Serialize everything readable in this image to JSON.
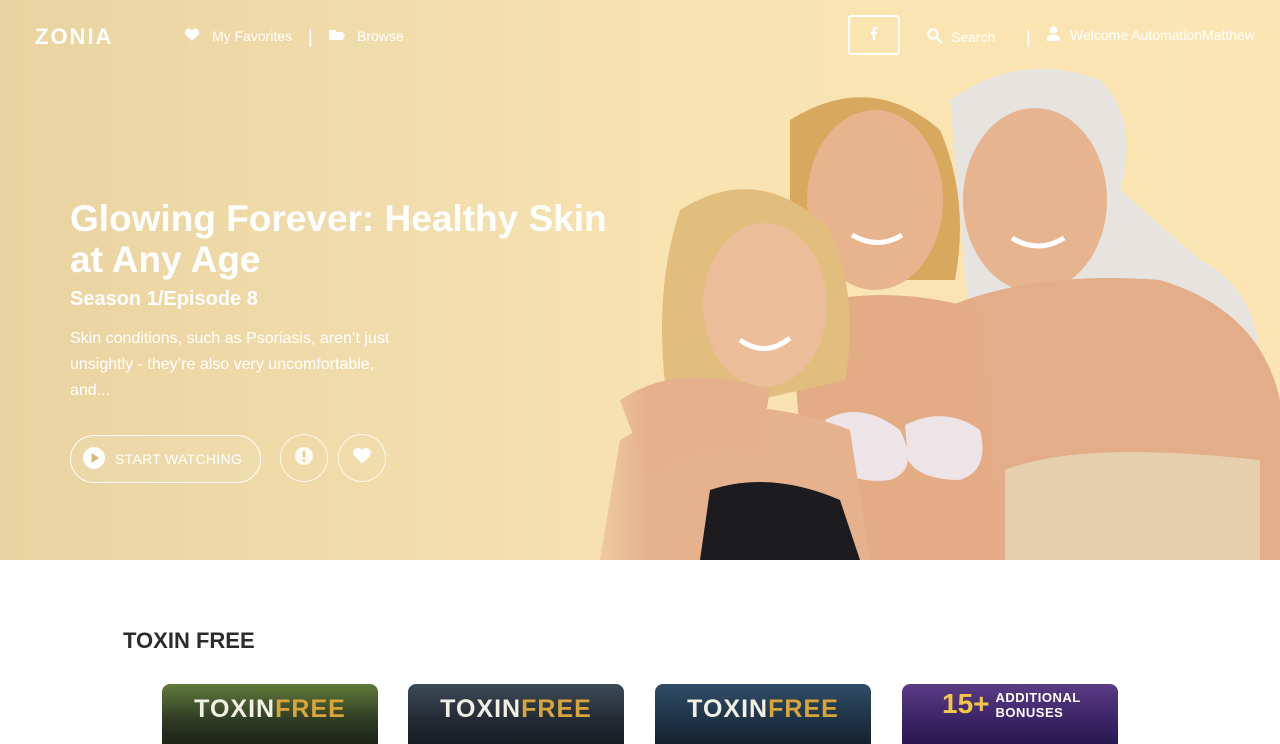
{
  "header": {
    "logo_text": "ZONIA",
    "nav": {
      "favorites_label": "My Favorites",
      "browse_label": "Browse"
    },
    "separator": "|",
    "facebook_icon": "facebook-icon",
    "search_label": "Search",
    "welcome_text": "Welcome AutomationMatthew"
  },
  "hero": {
    "title": "Glowing Forever: Healthy Skin at Any Age",
    "episode": "Season 1/Episode 8",
    "description": "Skin conditions, such as Psoriasis, aren’t just unsightly - they’re also very uncomfortable, and...",
    "start_label": "START WATCHING",
    "info_icon": "info-icon",
    "favorite_icon": "heart-icon"
  },
  "section": {
    "title": "TOXIN FREE",
    "cards": [
      {
        "w": "TOXIN",
        "g": "FREE"
      },
      {
        "w": "TOXIN",
        "g": "FREE"
      },
      {
        "w": "TOXIN",
        "g": "FREE"
      },
      {
        "number": "15+",
        "text_line1": "ADDITIONAL",
        "text_line2": "BONUSES"
      }
    ]
  },
  "colors": {
    "hero_bg": "#f8e3b1",
    "accent_gold": "#d8a53a",
    "text_dark": "#2c2c2c"
  }
}
